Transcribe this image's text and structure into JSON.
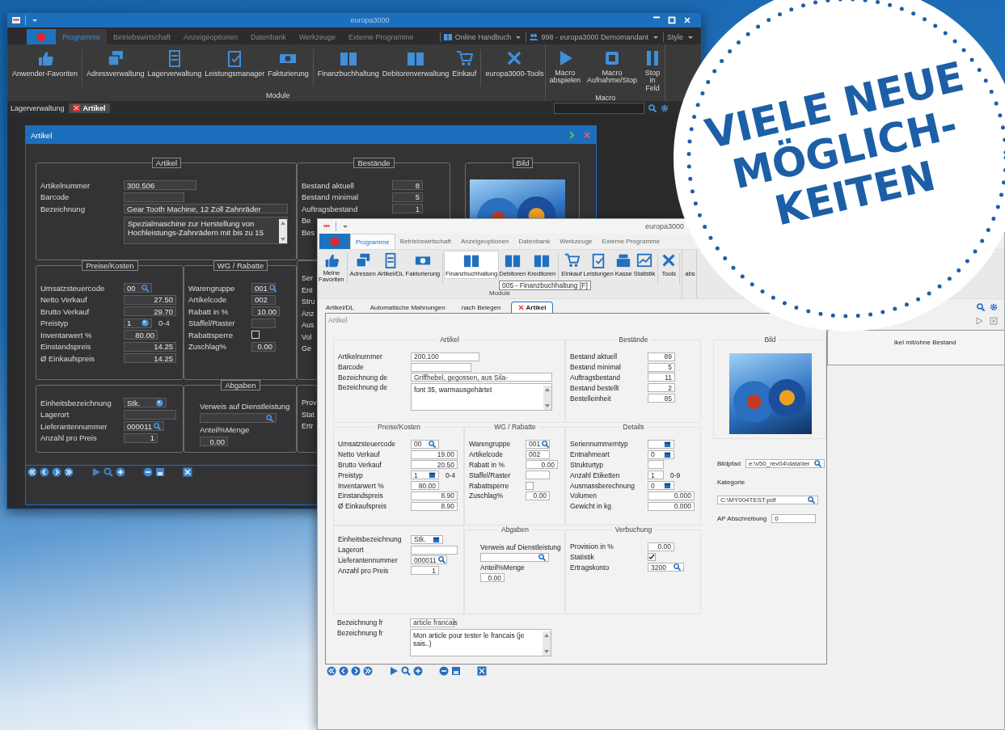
{
  "back_window": {
    "title": "europa3000",
    "tabs": [
      {
        "label": "Programme",
        "selected": true
      },
      {
        "label": "Betriebswirtschaft",
        "selected": false
      },
      {
        "label": "Anzeigeoptionen",
        "selected": false
      },
      {
        "label": "Datenbank",
        "selected": false
      },
      {
        "label": "Werkzeuge",
        "selected": false
      },
      {
        "label": "Externe Programme",
        "selected": false
      }
    ],
    "quick_links": [
      "Online Handbuch",
      "998 - europa3000 Demomandant",
      "Style"
    ],
    "ribbon": {
      "groups": [
        {
          "label": "Module",
          "buttons": [
            {
              "label": "Anwender-Favoriten"
            },
            {
              "label": "Adressverwaltung"
            },
            {
              "label": "Lagerverwaltung"
            },
            {
              "label": "Leistungsmanager"
            },
            {
              "label": "Fakturierung"
            },
            {
              "label": "Finanzbuchhaltung"
            },
            {
              "label": "Debitorenverwaltung"
            },
            {
              "label": "Einkauf"
            },
            {
              "label": "europa3000-Tools"
            }
          ]
        },
        {
          "label": "Macro",
          "buttons": [
            {
              "label": "Macro abspielen"
            },
            {
              "label": "Macro Aufnahme/Stop"
            },
            {
              "label": "Stop in Feld"
            }
          ]
        }
      ]
    },
    "breadcrumb": "Lagerverwaltung",
    "doc_tab": "Artikel",
    "form": {
      "title": "Artikel",
      "groups": [
        {
          "title": "Artikel",
          "framed": true,
          "rows": [
            {
              "label": "Artikelnummer",
              "kind": "text",
              "value": "300.506"
            },
            {
              "label": "Barcode",
              "kind": "text"
            },
            {
              "label": "Bezeichnung",
              "kind": "text",
              "value": "Gear Tooth Machine, 12 Zoll Zahnräder"
            },
            {
              "kind": "memo",
              "value": "Spezialmaschine zur Herstellung von Hochleistungs-Zahnrädern mit bis zu 15"
            }
          ]
        },
        {
          "title": "Bestände",
          "framed": true,
          "rows": [
            {
              "label": "Bestand aktuell",
              "kind": "num",
              "value": "8"
            },
            {
              "label": "Bestand minimal",
              "kind": "num",
              "value": "5"
            },
            {
              "label": "Auftragsbestand",
              "kind": "num",
              "value": "1"
            },
            {
              "label": "Be",
              "kind": "label"
            },
            {
              "label": "Bes",
              "kind": "label"
            }
          ]
        },
        {
          "title": "Bild",
          "framed": true,
          "photo": true
        },
        {
          "title": "Preise/Kosten",
          "framed": true,
          "rows": [
            {
              "label": "Umsatzsteuercode",
              "kind": "lookup",
              "value": "00"
            },
            {
              "label": "Netto Verkauf",
              "kind": "num",
              "value": "27.50"
            },
            {
              "label": "Brutto Verkauf",
              "kind": "num",
              "value": "29.70"
            },
            {
              "label": "Preistyp",
              "kind": "picker",
              "value": "1",
              "suffix": "0-4"
            },
            {
              "label": "Inventarwert %",
              "kind": "num",
              "value": "80.00"
            },
            {
              "label": "Einstandspreis",
              "kind": "num",
              "value": "14.25"
            },
            {
              "label": "Ø Einkaufspreis",
              "kind": "num",
              "value": "14.25"
            }
          ]
        },
        {
          "title": "WG / Rabatte",
          "framed": true,
          "rows": [
            {
              "label": "Warengruppe",
              "kind": "lookup",
              "value": "001"
            },
            {
              "label": "Artikelcode",
              "kind": "text",
              "value": "002"
            },
            {
              "label": "Rabatt in %",
              "kind": "num",
              "value": "10.00"
            },
            {
              "label": "Staffel/Raster",
              "kind": "text"
            },
            {
              "label": "Rabattsperre",
              "kind": "check",
              "checked": false
            },
            {
              "label": "Zuschlag%",
              "kind": "num",
              "value": "0.00"
            }
          ]
        },
        {
          "framed": true,
          "rows": [
            {
              "label": "Ser",
              "kind": "label"
            },
            {
              "label": "Ent",
              "kind": "label"
            },
            {
              "label": "Stru",
              "kind": "label"
            },
            {
              "label": "Anz",
              "kind": "label"
            },
            {
              "label": "Aus",
              "kind": "label"
            },
            {
              "label": "Vol",
              "kind": "label"
            },
            {
              "label": "Ge",
              "kind": "label"
            }
          ]
        },
        {
          "framed": true,
          "rows": [
            {
              "label": "Einheitsbezeichnung",
              "kind": "picker",
              "value": "Stk."
            },
            {
              "label": "Lagerort",
              "kind": "text"
            },
            {
              "label": "Lieferantennummer",
              "kind": "lookup",
              "value": "000011"
            },
            {
              "label": "Anzahl pro Preis",
              "kind": "num",
              "value": "1"
            }
          ]
        },
        {
          "title": "Abgaben",
          "framed": true,
          "rows": [
            {
              "label": "Verweis auf Dienstleistung",
              "kind": "lookup"
            },
            {
              "label": "Anteil%Menge",
              "kind": "num",
              "value": "0.00"
            }
          ]
        },
        {
          "framed": true,
          "rows": [
            {
              "label": "Prov",
              "kind": "label"
            },
            {
              "label": "Stat",
              "kind": "label"
            },
            {
              "label": "Ertr",
              "kind": "label"
            }
          ]
        }
      ]
    }
  },
  "front_window": {
    "title": "europa3000",
    "tabs": [
      {
        "label": "Programme",
        "selected": true
      },
      {
        "label": "Betriebswirtschaft",
        "selected": false
      },
      {
        "label": "Anzeigeoptionen",
        "selected": false
      },
      {
        "label": "Datenbank",
        "selected": false
      },
      {
        "label": "Werkzeuge",
        "selected": false
      },
      {
        "label": "Externe Programme",
        "selected": false
      }
    ],
    "ribbon": {
      "groups": [
        {
          "label": "Module",
          "buttons": [
            {
              "label": "Meine Favoriten",
              "highlighted": false
            },
            {
              "label": "Adressen",
              "highlighted": false
            },
            {
              "label": "Artikel/DL",
              "highlighted": false
            },
            {
              "label": "Fakturierung",
              "highlighted": false
            },
            {
              "label": "Finanzbuchhaltung",
              "highlighted": true
            },
            {
              "label": "Debitoren",
              "highlighted": false
            },
            {
              "label": "Kreditoren",
              "highlighted": false
            },
            {
              "label": "Einkauf",
              "highlighted": false
            },
            {
              "label": "Leistungen",
              "highlighted": false
            },
            {
              "label": "Kasse",
              "highlighted": false
            },
            {
              "label": "Statistik",
              "highlighted": false
            },
            {
              "label": "Tools",
              "highlighted": false
            }
          ]
        },
        {
          "buttons": [
            {
              "label": "abs",
              "highlighted": false
            }
          ]
        }
      ]
    },
    "tooltip": "005 - Finanzbuchhaltung [F]",
    "doc_tabs": [
      {
        "label": "Artikel/DL",
        "selected": false
      },
      {
        "label": "Automatische Mahnungen",
        "selected": false
      },
      {
        "label": "nach Belegen",
        "selected": false
      },
      {
        "label": "Artikel",
        "selected": true
      }
    ],
    "form": {
      "title": "Artikel",
      "groups": [
        {
          "title": "Artikel",
          "framed": true,
          "rows": [
            {
              "label": "Artikelnummer",
              "kind": "text",
              "value": "200.100"
            },
            {
              "label": "Barcode",
              "kind": "text"
            },
            {
              "label": "Bezeichnung de",
              "kind": "text",
              "value": "Griffhebel, gegossen, aus Sila-"
            },
            {
              "label": "Bezeichnung de",
              "kind": "memo",
              "value": "font 35, warmausgehärtet"
            }
          ]
        },
        {
          "title": "Bestände",
          "framed": true,
          "rows": [
            {
              "label": "Bestand aktuell",
              "kind": "num",
              "value": "89"
            },
            {
              "label": "Bestand minimal",
              "kind": "num",
              "value": "5"
            },
            {
              "label": "Auftragsbestand",
              "kind": "num",
              "value": "11"
            },
            {
              "label": "Bestand bestellt",
              "kind": "num",
              "value": "2"
            },
            {
              "label": "Bestelleinheit",
              "kind": "num",
              "value": "85"
            }
          ]
        },
        {
          "title": "Bild",
          "framed": true,
          "photo": true
        },
        {
          "framed": false,
          "rows": [
            {
              "label": "Bildpfad",
              "kind": "lookup",
              "value": "e:\\v50_rev04\\data\\ter"
            },
            {
              "label": "Kategorie",
              "kind": "label"
            },
            {
              "kind": "lookup",
              "value": "C:\\MY004TEST.pdf"
            },
            {
              "label": "AP Abschreibung",
              "kind": "text",
              "value": "0"
            }
          ]
        },
        {
          "title": "Preise/Kosten",
          "framed": true,
          "rows": [
            {
              "label": "Umsatzsteuercode",
              "kind": "lookup",
              "value": "00"
            },
            {
              "label": "Netto Verkauf",
              "kind": "num",
              "value": "19.00"
            },
            {
              "label": "Brutto Verkauf",
              "kind": "num",
              "value": "20.50"
            },
            {
              "label": "Preistyp",
              "kind": "picker",
              "value": "1",
              "suffix": "0-4"
            },
            {
              "label": "Inventarwert %",
              "kind": "num",
              "value": "80.00"
            },
            {
              "label": "Einstandspreis",
              "kind": "num",
              "value": "8.90"
            },
            {
              "label": "Ø Einkaufspreis",
              "kind": "num",
              "value": "8.90"
            }
          ]
        },
        {
          "title": "WG / Rabatte",
          "framed": true,
          "rows": [
            {
              "label": "Warengruppe",
              "kind": "lookup",
              "value": "001"
            },
            {
              "label": "Artikelcode",
              "kind": "text",
              "value": "002"
            },
            {
              "label": "Rabatt in %",
              "kind": "num",
              "value": "0.00"
            },
            {
              "label": "Staffel/Raster",
              "kind": "text"
            },
            {
              "label": "Rabattsperre",
              "kind": "check",
              "checked": false
            },
            {
              "label": "Zuschlag%",
              "kind": "num",
              "value": "0.00"
            }
          ]
        },
        {
          "title": "Details",
          "framed": true,
          "rows": [
            {
              "label": "Seriennummerntyp",
              "kind": "picker"
            },
            {
              "label": "Entnahmeart",
              "kind": "picker",
              "value": "0"
            },
            {
              "label": "Strukturtyp",
              "kind": "text"
            },
            {
              "label": "Anzahl Etiketten",
              "kind": "text",
              "value": "1",
              "suffix": "0-9"
            },
            {
              "label": "Ausmassberechnung",
              "kind": "picker",
              "value": "0"
            },
            {
              "label": "Volumen",
              "kind": "num",
              "value": "0.000"
            },
            {
              "label": "Gewicht in kg",
              "kind": "num",
              "value": "0.000"
            }
          ]
        },
        {
          "framed": true,
          "rows": [
            {
              "label": "Einheitsbezeichnung",
              "kind": "picker",
              "value": "Stk."
            },
            {
              "label": "Lagerort",
              "kind": "text"
            },
            {
              "label": "Lieferantennummer",
              "kind": "lookup",
              "value": "000011"
            },
            {
              "label": "Anzahl pro Preis",
              "kind": "num",
              "value": "1"
            }
          ]
        },
        {
          "title": "Abgaben",
          "framed": true,
          "rows": [
            {
              "label": "Verweis auf Dienstleistung",
              "kind": "lookup"
            },
            {
              "label": "Anteil%Menge",
              "kind": "num",
              "value": "0.00"
            }
          ]
        },
        {
          "title": "Verbuchung",
          "framed": true,
          "rows": [
            {
              "label": "Provision in %",
              "kind": "num",
              "value": "0.00"
            },
            {
              "label": "Statistik",
              "kind": "check",
              "checked": true
            },
            {
              "label": "Ertragskonto",
              "kind": "lookup",
              "value": "3200"
            }
          ]
        },
        {
          "framed": false,
          "rows": [
            {
              "label": "Bezeichnung fr",
              "kind": "text",
              "value": "article francais"
            },
            {
              "label": "Bezeichnung fr",
              "kind": "memo",
              "value": "Mon article pour tester le francais (je sais..)"
            }
          ]
        }
      ]
    },
    "side_panel": {
      "text": "ikel mit/ohne Bestand"
    }
  },
  "badge": {
    "lines": [
      "VIELE NEUE",
      "MÖGLICH-",
      "KEITEN"
    ]
  }
}
